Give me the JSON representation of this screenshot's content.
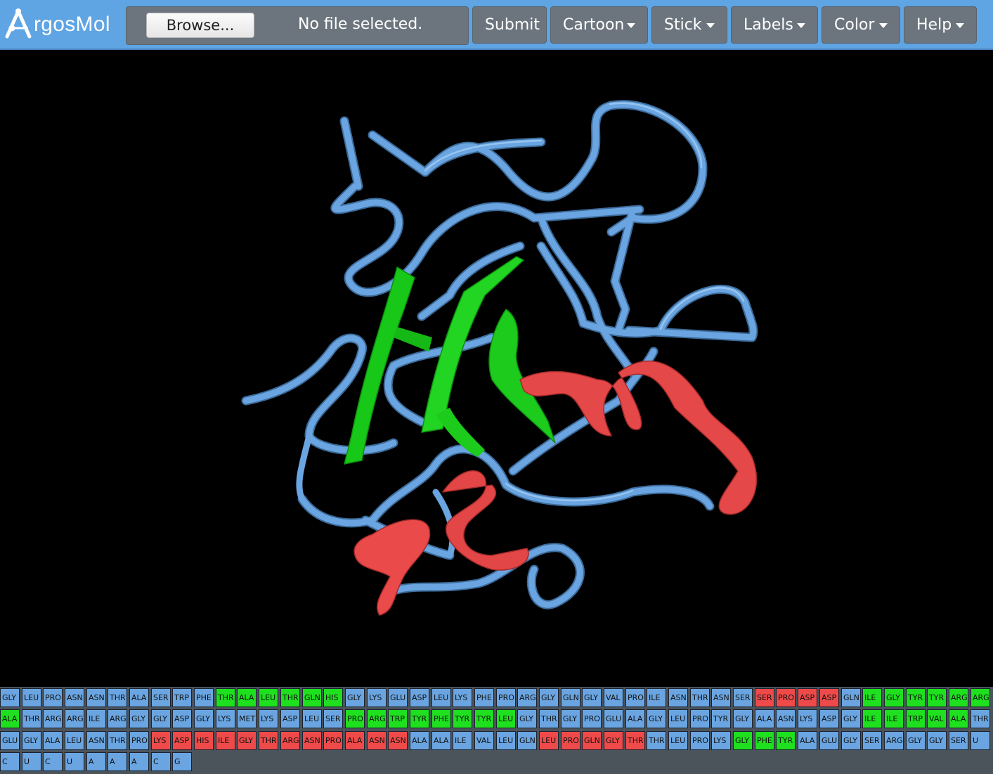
{
  "navbar": {
    "brand": "rgosMol",
    "brand_mark": "argosmol-logo-icon",
    "browse_label": "Browse...",
    "file_status": "No file selected.",
    "submit_label": "Submit",
    "menus": [
      {
        "label": "Cartoon"
      },
      {
        "label": "Stick"
      },
      {
        "label": "Labels"
      },
      {
        "label": "Color"
      },
      {
        "label": "Help"
      }
    ]
  },
  "colors": {
    "navbar_bg": "#5fa4e3",
    "button_bg": "#6c757d",
    "coil": "#6aa5e1",
    "sheet": "#1ee01e",
    "helix": "#ef4a4a",
    "viewer_bg": "#000000",
    "sequence_panel_bg": "#4b535b"
  },
  "viewer": {
    "representation": "cartoon",
    "structure_icon": "protein-ribbon-cartoon"
  },
  "sequence": {
    "rows": [
      [
        [
          "GLY",
          "b"
        ],
        [
          "LEU",
          "b"
        ],
        [
          "PRO",
          "b"
        ],
        [
          "ASN",
          "b"
        ],
        [
          "ASN",
          "b"
        ],
        [
          "THR",
          "b"
        ],
        [
          "ALA",
          "b"
        ],
        [
          "SER",
          "b"
        ],
        [
          "TRP",
          "b"
        ],
        [
          "PHE",
          "b"
        ],
        [
          "THR",
          "g"
        ],
        [
          "ALA",
          "g"
        ],
        [
          "LEU",
          "g"
        ],
        [
          "THR",
          "g"
        ],
        [
          "GLN",
          "g"
        ],
        [
          "HIS",
          "g"
        ],
        [
          "GLY",
          "b"
        ],
        [
          "LYS",
          "b"
        ],
        [
          "GLU",
          "b"
        ],
        [
          "ASP",
          "b"
        ],
        [
          "LEU",
          "b"
        ],
        [
          "LYS",
          "b"
        ],
        [
          "PHE",
          "b"
        ],
        [
          "PRO",
          "b"
        ],
        [
          "ARG",
          "b"
        ],
        [
          "GLY",
          "b"
        ],
        [
          "GLN",
          "b"
        ],
        [
          "GLY",
          "b"
        ],
        [
          "VAL",
          "b"
        ],
        [
          "PRO",
          "b"
        ],
        [
          "ILE",
          "b"
        ],
        [
          "ASN",
          "b"
        ],
        [
          "THR",
          "b"
        ],
        [
          "ASN",
          "b"
        ],
        [
          "SER",
          "b"
        ],
        [
          "SER",
          "r"
        ],
        [
          "PRO",
          "r"
        ],
        [
          "ASP",
          "r"
        ],
        [
          "ASP",
          "r"
        ],
        [
          "GLN",
          "b"
        ],
        [
          "ILE",
          "g"
        ],
        [
          "GLY",
          "g"
        ],
        [
          "TYR",
          "g"
        ],
        [
          "TYR",
          "g"
        ],
        [
          "ARG",
          "g"
        ],
        [
          "ARG",
          "g"
        ]
      ],
      [
        [
          "ALA",
          "g"
        ],
        [
          "THR",
          "b"
        ],
        [
          "ARG",
          "b"
        ],
        [
          "ARG",
          "b"
        ],
        [
          "ILE",
          "b"
        ],
        [
          "ARG",
          "b"
        ],
        [
          "GLY",
          "b"
        ],
        [
          "GLY",
          "b"
        ],
        [
          "ASP",
          "b"
        ],
        [
          "GLY",
          "b"
        ],
        [
          "LYS",
          "b"
        ],
        [
          "MET",
          "b"
        ],
        [
          "LYS",
          "b"
        ],
        [
          "ASP",
          "b"
        ],
        [
          "LEU",
          "b"
        ],
        [
          "SER",
          "b"
        ],
        [
          "PRO",
          "g"
        ],
        [
          "ARG",
          "g"
        ],
        [
          "TRP",
          "g"
        ],
        [
          "TYR",
          "g"
        ],
        [
          "PHE",
          "g"
        ],
        [
          "TYR",
          "g"
        ],
        [
          "TYR",
          "g"
        ],
        [
          "LEU",
          "g"
        ],
        [
          "GLY",
          "b"
        ],
        [
          "THR",
          "b"
        ],
        [
          "GLY",
          "b"
        ],
        [
          "PRO",
          "b"
        ],
        [
          "GLU",
          "b"
        ],
        [
          "ALA",
          "b"
        ],
        [
          "GLY",
          "b"
        ],
        [
          "LEU",
          "b"
        ],
        [
          "PRO",
          "b"
        ],
        [
          "TYR",
          "b"
        ],
        [
          "GLY",
          "b"
        ],
        [
          "ALA",
          "b"
        ],
        [
          "ASN",
          "b"
        ],
        [
          "LYS",
          "b"
        ],
        [
          "ASP",
          "b"
        ],
        [
          "GLY",
          "b"
        ],
        [
          "ILE",
          "g"
        ],
        [
          "ILE",
          "g"
        ],
        [
          "TRP",
          "g"
        ],
        [
          "VAL",
          "g"
        ],
        [
          "ALA",
          "g"
        ],
        [
          "THR",
          "b"
        ]
      ],
      [
        [
          "GLU",
          "b"
        ],
        [
          "GLY",
          "b"
        ],
        [
          "ALA",
          "b"
        ],
        [
          "LEU",
          "b"
        ],
        [
          "ASN",
          "b"
        ],
        [
          "THR",
          "b"
        ],
        [
          "PRO",
          "b"
        ],
        [
          "LYS",
          "r"
        ],
        [
          "ASP",
          "r"
        ],
        [
          "HIS",
          "r"
        ],
        [
          "ILE",
          "r"
        ],
        [
          "GLY",
          "r"
        ],
        [
          "THR",
          "r"
        ],
        [
          "ARG",
          "r"
        ],
        [
          "ASN",
          "r"
        ],
        [
          "PRO",
          "r"
        ],
        [
          "ALA",
          "r"
        ],
        [
          "ASN",
          "r"
        ],
        [
          "ASN",
          "r"
        ],
        [
          "ALA",
          "b"
        ],
        [
          "ALA",
          "b"
        ],
        [
          "ILE",
          "b"
        ],
        [
          "VAL",
          "b"
        ],
        [
          "LEU",
          "b"
        ],
        [
          "GLN",
          "b"
        ],
        [
          "LEU",
          "r"
        ],
        [
          "PRO",
          "r"
        ],
        [
          "GLN",
          "r"
        ],
        [
          "GLY",
          "r"
        ],
        [
          "THR",
          "r"
        ],
        [
          "THR",
          "b"
        ],
        [
          "LEU",
          "b"
        ],
        [
          "PRO",
          "b"
        ],
        [
          "LYS",
          "b"
        ],
        [
          "GLY",
          "g"
        ],
        [
          "PHE",
          "g"
        ],
        [
          "TYR",
          "g"
        ],
        [
          "ALA",
          "b"
        ],
        [
          "GLU",
          "b"
        ],
        [
          "GLY",
          "b"
        ],
        [
          "SER",
          "b"
        ],
        [
          "ARG",
          "b"
        ],
        [
          "GLY",
          "b"
        ],
        [
          "GLY",
          "b"
        ],
        [
          "SER",
          "b"
        ],
        [
          "U",
          "b"
        ]
      ],
      [
        [
          "C",
          "b"
        ],
        [
          "U",
          "b"
        ],
        [
          "C",
          "b"
        ],
        [
          "U",
          "b"
        ],
        [
          "A",
          "b"
        ],
        [
          "A",
          "b"
        ],
        [
          "A",
          "b"
        ],
        [
          "C",
          "b"
        ],
        [
          "G",
          "b"
        ]
      ]
    ]
  }
}
